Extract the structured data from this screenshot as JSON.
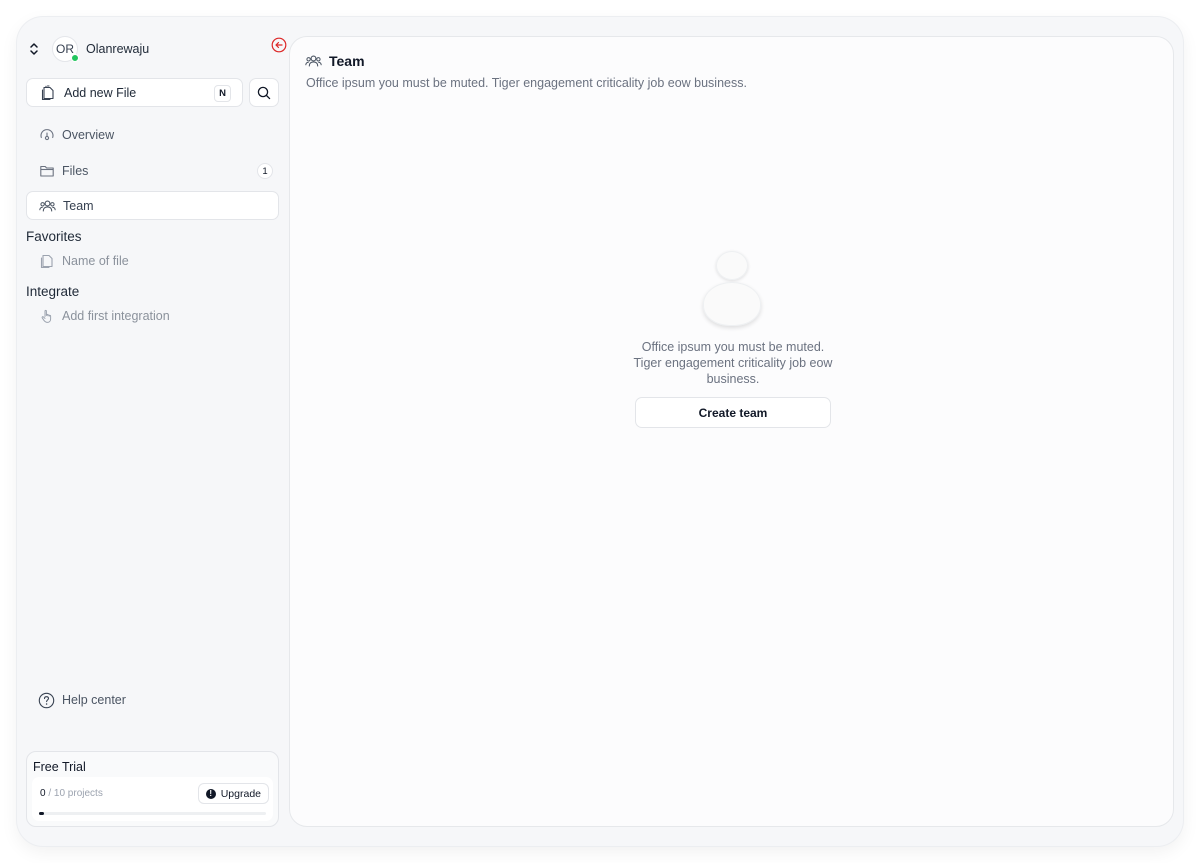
{
  "user": {
    "initials": "OR",
    "name": "Olanrewaju",
    "status_color": "#22c55e"
  },
  "sidebar": {
    "add_file": {
      "label": "Add new File",
      "shortcut": "N"
    },
    "nav": [
      {
        "label": "Overview",
        "icon": "overview-icon"
      },
      {
        "label": "Files",
        "icon": "folder-icon",
        "count": "1"
      },
      {
        "label": "Team",
        "icon": "team-icon",
        "active": true
      }
    ],
    "favorites": {
      "title": "Favorites",
      "items": [
        {
          "label": "Name of file",
          "icon": "file-icon"
        }
      ]
    },
    "integrate": {
      "title": "Integrate",
      "items": [
        {
          "label": "Add first integration",
          "icon": "pointer-icon"
        }
      ]
    },
    "help": {
      "label": "Help center",
      "icon": "help-icon"
    },
    "trial": {
      "title": "Free Trial",
      "used": "0",
      "limit": "/ 10 projects",
      "upgrade_label": "Upgrade",
      "progress": 0.02
    }
  },
  "main": {
    "title": "Team",
    "description": "Office ipsum you must be muted. Tiger engagement criticality job eow business.",
    "empty_state": {
      "text": "Office ipsum you must be muted. Tiger engagement criticality job eow business.",
      "button_label": "Create team"
    }
  },
  "colors": {
    "accent_collapse": "#dc2626",
    "primary_text": "#111827"
  }
}
